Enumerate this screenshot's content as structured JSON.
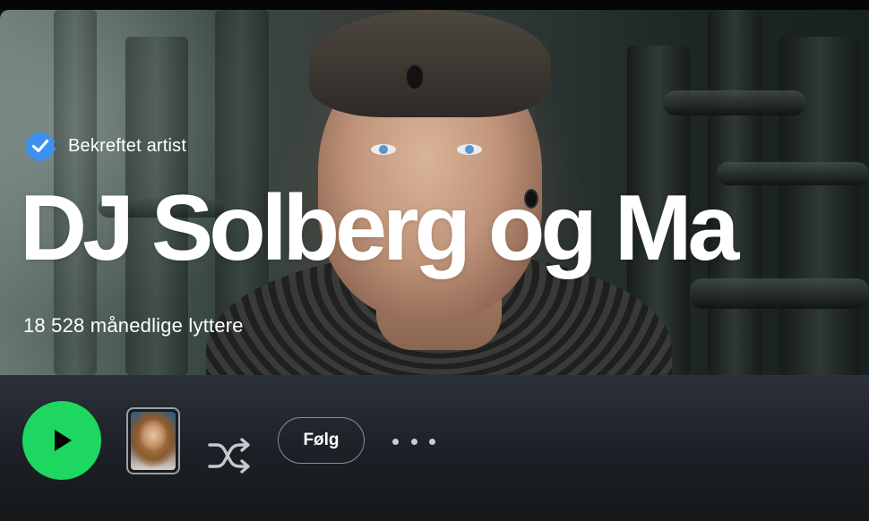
{
  "hero": {
    "verified_label": "Bekreftet artist",
    "artist_name": "DJ Solberg og Ma",
    "monthly_listeners": "18 528 månedlige lyttere",
    "verified_badge_color": "#3d91f4",
    "verified_icon": "verified-badge-icon",
    "artwork": "artist-banner-image"
  },
  "actions": {
    "play_icon": "play-icon",
    "play_color": "#1ed760",
    "thumbnail": "artist-pick-thumbnail",
    "shuffle_icon": "shuffle-icon",
    "follow_label": "Følg",
    "more_icon": "more-options-icon"
  }
}
